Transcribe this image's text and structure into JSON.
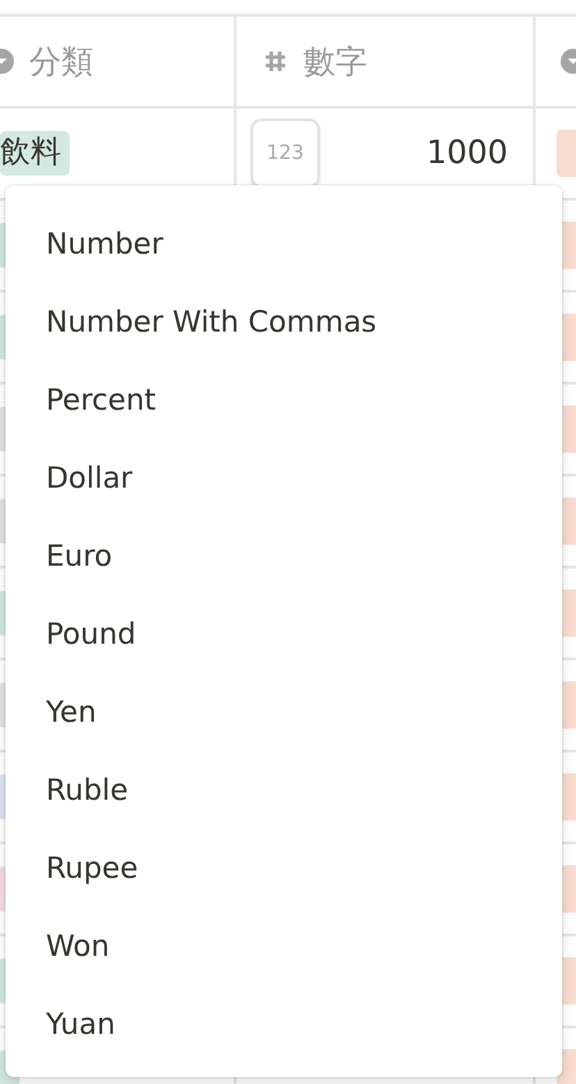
{
  "columns": [
    {
      "label": "分類",
      "kind": "list"
    },
    {
      "label": "數字",
      "kind": "number"
    },
    {
      "kind": "list"
    }
  ],
  "rows": [
    {
      "category": "飲料",
      "number": "1000",
      "format_button": "123",
      "color": "#d3e8e2"
    },
    {
      "color": "#d3e8e2"
    },
    {
      "color": "#d3e8e2"
    },
    {
      "color": "#e3e2e0"
    },
    {
      "color": "#e3e2e0"
    },
    {
      "color": "#d3e8e2"
    },
    {
      "color": "#e3e2e0"
    },
    {
      "color": "#d9e4f0"
    },
    {
      "color": "#f3dbe8"
    },
    {
      "color": "#d3e8e2"
    },
    {
      "color": "#d3e8e2"
    }
  ],
  "menu": {
    "items": [
      "Number",
      "Number With Commas",
      "Percent",
      "Dollar",
      "Euro",
      "Pound",
      "Yen",
      "Ruble",
      "Rupee",
      "Won",
      "Yuan"
    ]
  }
}
